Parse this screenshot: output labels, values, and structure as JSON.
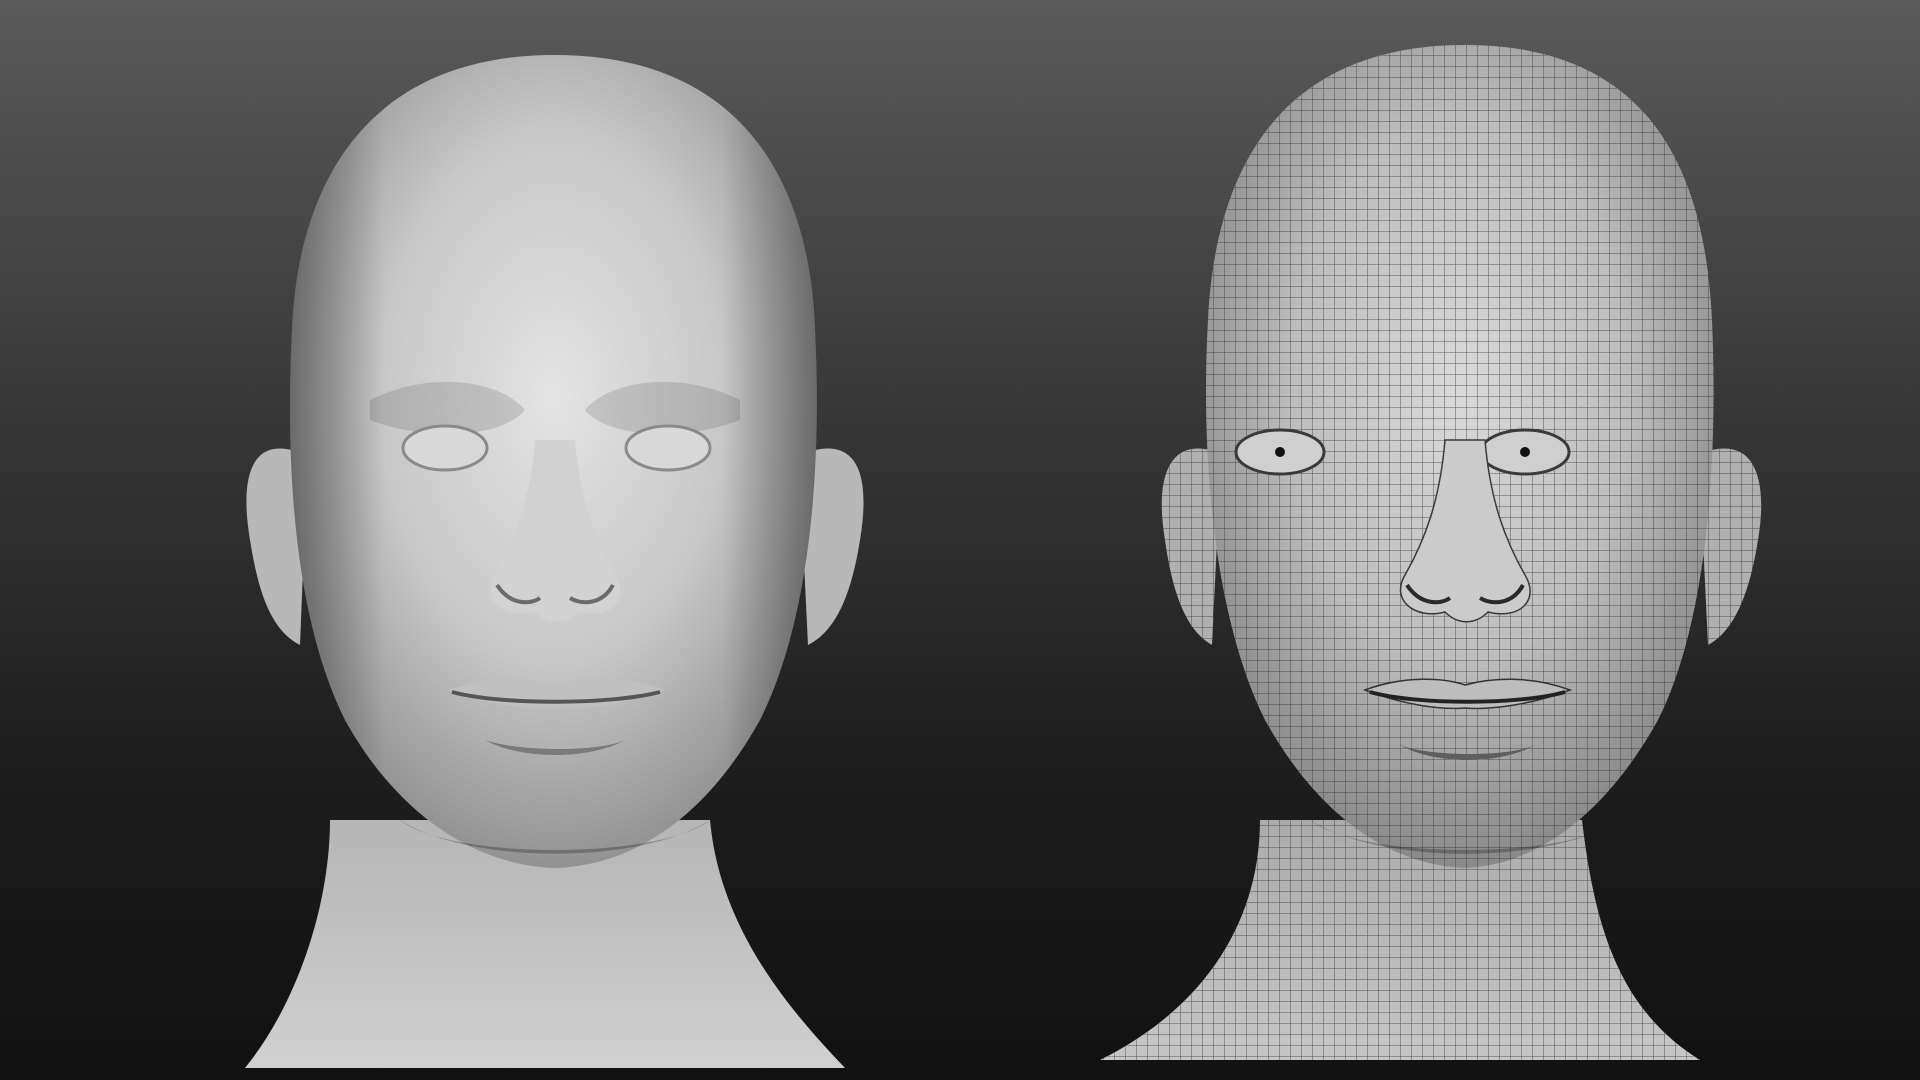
{
  "scene": {
    "background_top": "#5a5a5a",
    "background_bottom": "#111111",
    "surface_color": "#c9c9c9",
    "wire_color": "#2e2e2e"
  },
  "renders": [
    {
      "id": "shaded",
      "display_mode": "flat-shaded"
    },
    {
      "id": "wireframe",
      "display_mode": "shaded-with-wireframe"
    }
  ]
}
